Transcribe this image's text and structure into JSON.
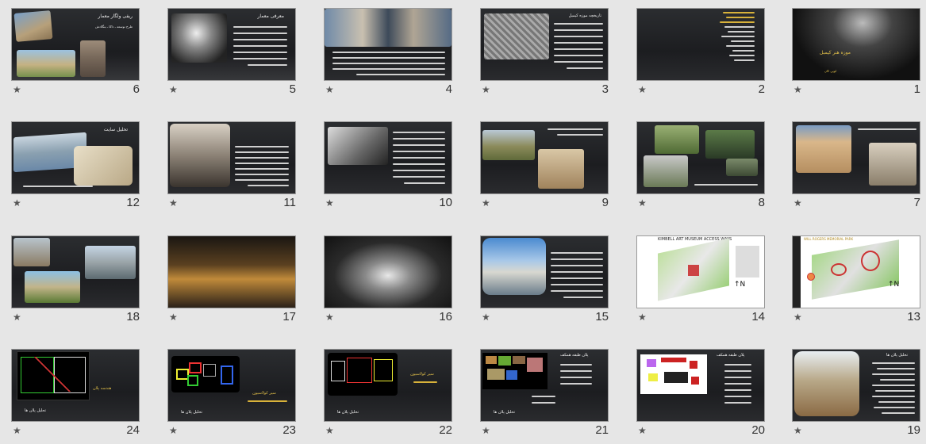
{
  "slides": [
    {
      "row": 0,
      "col": 0,
      "number": "6",
      "title": "ریفی ولگار معمار",
      "subtitle": "طرح توسعه ـ داکا ـ بنگلادش"
    },
    {
      "row": 0,
      "col": 1,
      "number": "5",
      "title": "معرفی معمار"
    },
    {
      "row": 0,
      "col": 2,
      "number": "4"
    },
    {
      "row": 0,
      "col": 3,
      "number": "3",
      "title": "تاریخچه موزه کیمبل"
    },
    {
      "row": 0,
      "col": 4,
      "number": "2"
    },
    {
      "row": 0,
      "col": 5,
      "number": "1",
      "title": "موزه هنر کیمبل",
      "subtitle": "لویی کان"
    },
    {
      "row": 1,
      "col": 0,
      "number": "12",
      "title": "تحلیل سایت"
    },
    {
      "row": 1,
      "col": 1,
      "number": "11"
    },
    {
      "row": 1,
      "col": 2,
      "number": "10"
    },
    {
      "row": 1,
      "col": 3,
      "number": "9"
    },
    {
      "row": 1,
      "col": 4,
      "number": "8"
    },
    {
      "row": 1,
      "col": 5,
      "number": "7"
    },
    {
      "row": 2,
      "col": 0,
      "number": "18"
    },
    {
      "row": 2,
      "col": 1,
      "number": "17"
    },
    {
      "row": 2,
      "col": 2,
      "number": "16"
    },
    {
      "row": 2,
      "col": 3,
      "number": "15"
    },
    {
      "row": 2,
      "col": 4,
      "number": "14",
      "title": "KIMBELL ART MUSEUM ACCESS WAYS"
    },
    {
      "row": 2,
      "col": 5,
      "number": "13",
      "title": "WILL ROGERS MEMORIAL PARK"
    },
    {
      "row": 3,
      "col": 0,
      "number": "24",
      "title": "تحلیل پلان ها",
      "subtitle": "هندسه پلان"
    },
    {
      "row": 3,
      "col": 1,
      "number": "23",
      "title": "تحلیل پلان ها",
      "subtitle": "سیر کولاسیون"
    },
    {
      "row": 3,
      "col": 2,
      "number": "22",
      "title": "تحلیل پلان ها",
      "subtitle": "سیر کولاسیون"
    },
    {
      "row": 3,
      "col": 3,
      "number": "21",
      "title": "تحلیل پلان ها",
      "subtitle": "پلان طبقه همکف"
    },
    {
      "row": 3,
      "col": 4,
      "number": "20",
      "title": "پلان طبقه همکف"
    },
    {
      "row": 3,
      "col": 5,
      "number": "19",
      "title": "تحلیل پلان ها"
    }
  ],
  "colors": {
    "background": "#e6e6e6",
    "slide_bg": "#24262a",
    "accent": "#d8b23a"
  },
  "star_icon": "★"
}
